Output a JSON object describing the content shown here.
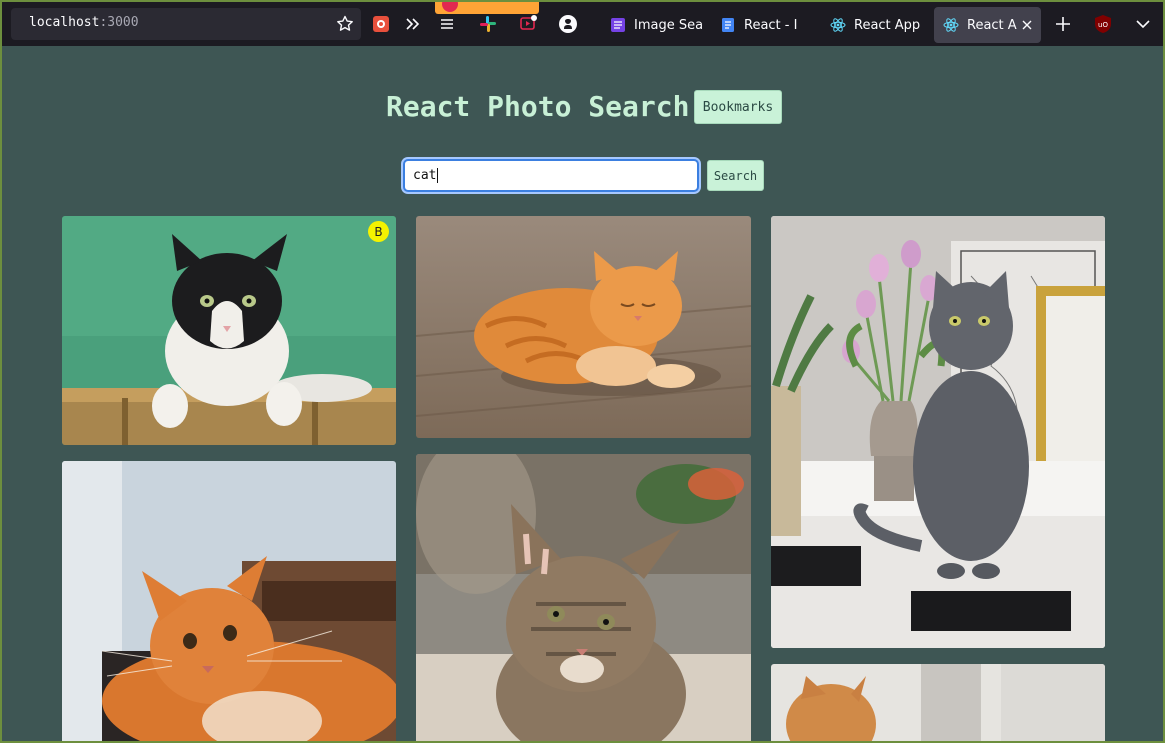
{
  "browser": {
    "url_host": "localhost",
    "url_port": ":3000",
    "tabs": [
      {
        "label": "Image Sea",
        "icon": "page-icon"
      },
      {
        "label": "React - I",
        "icon": "docs-icon"
      },
      {
        "label": "React App",
        "icon": "react-icon"
      },
      {
        "label": "React A",
        "icon": "react-icon",
        "active": true
      }
    ]
  },
  "page": {
    "title": "React Photo Search",
    "bookmarks_label": "Bookmarks",
    "search": {
      "value": "cat",
      "button_label": "Search"
    },
    "photos": [
      {
        "subject": "black-and-white cat on green background",
        "bookmarked": true,
        "badge": "B"
      },
      {
        "subject": "orange tabby cat lying on wooden floor",
        "bookmarked": false
      },
      {
        "subject": "grey cat beside tulips on white shelf",
        "bookmarked": false
      },
      {
        "subject": "orange long-haired cat looking up",
        "bookmarked": false
      },
      {
        "subject": "tabby kitten",
        "bookmarked": false
      },
      {
        "subject": "orange cat",
        "bookmarked": false
      }
    ]
  },
  "colors": {
    "page_bg": "#3e5654",
    "accent": "#c9f2d8",
    "title": "#c8f0d6",
    "badge": "#f5f200"
  }
}
